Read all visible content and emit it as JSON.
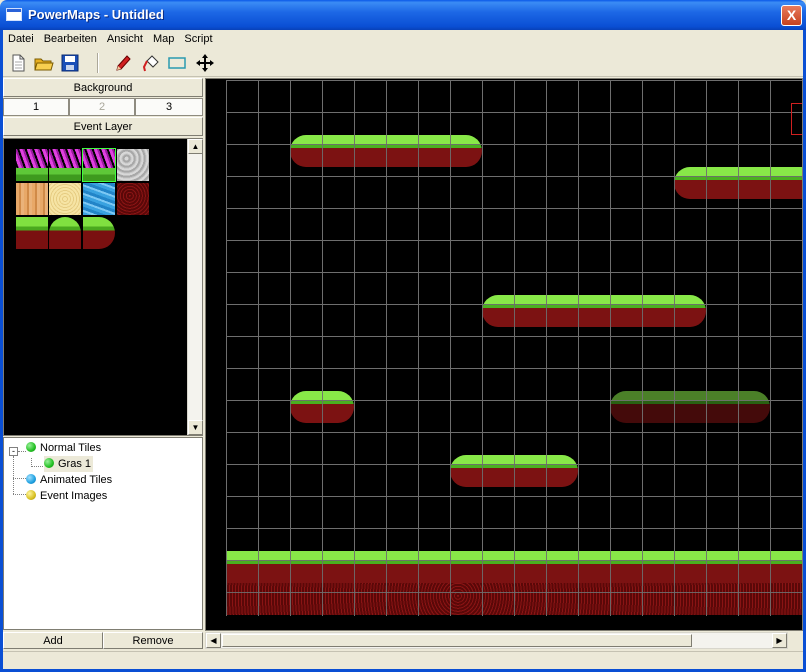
{
  "window": {
    "title": "PowerMaps - Untidled",
    "close_label": "X"
  },
  "menu": {
    "items": [
      {
        "label": "Datei"
      },
      {
        "label": "Bearbeiten"
      },
      {
        "label": "Ansicht"
      },
      {
        "label": "Map"
      },
      {
        "label": "Script"
      }
    ]
  },
  "toolbar": {
    "buttons": [
      "new-file-icon",
      "open-folder-icon",
      "save-disk-icon",
      "pencil-icon",
      "fill-bucket-icon",
      "rectangle-icon",
      "move-cross-icon"
    ]
  },
  "left_panel": {
    "background_header": "Background",
    "layer_tabs": [
      {
        "label": "1",
        "enabled": true
      },
      {
        "label": "2",
        "enabled": false
      },
      {
        "label": "3",
        "enabled": true
      }
    ],
    "event_layer_header": "Event Layer"
  },
  "tree": {
    "items": [
      {
        "label": "Normal Tiles",
        "dot_color": "#22c022"
      },
      {
        "label": "Gras 1",
        "dot_color": "#22c022"
      },
      {
        "label": "Animated Tiles",
        "dot_color": "#1ea0e0"
      },
      {
        "label": "Event Images",
        "dot_color": "#d8c020"
      }
    ],
    "selected": "Gras 1"
  },
  "buttons": {
    "add_label": "Add",
    "remove_label": "Remove"
  },
  "colors": {
    "grid": "#6e6e6e",
    "map_bg": "#000000",
    "titlebar": "#0a4fd4"
  }
}
